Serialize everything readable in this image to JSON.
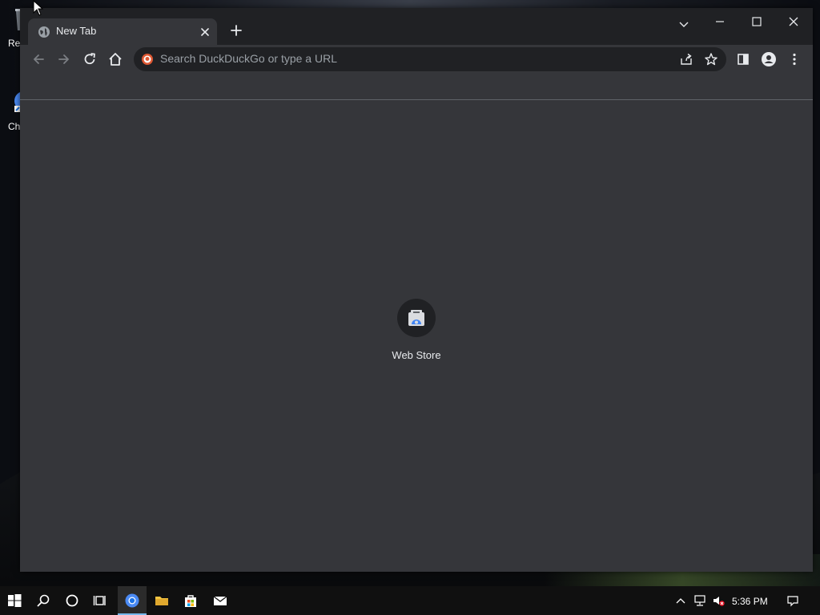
{
  "desktop": {
    "icons": [
      {
        "label": "Rec",
        "icon": "recycle-bin-icon"
      },
      {
        "label": "Ch",
        "icon": "chrome-shortcut-icon"
      }
    ]
  },
  "browser": {
    "tab": {
      "title": "New Tab",
      "favicon": "globe-icon"
    },
    "toolbar": {
      "address_placeholder": "Search DuckDuckGo or type a URL",
      "search_engine_icon": "duckduckgo-icon"
    },
    "shortcuts": [
      {
        "label": "Web Store",
        "icon": "web-store-icon"
      }
    ],
    "colors": {
      "frame": "#202124",
      "surface": "#35363a",
      "text": "#e8eaed",
      "placeholder": "#9aa0a6"
    }
  },
  "taskbar": {
    "clock": "5:36 PM",
    "active_app": "chrome",
    "accent": "#76b9ed"
  }
}
